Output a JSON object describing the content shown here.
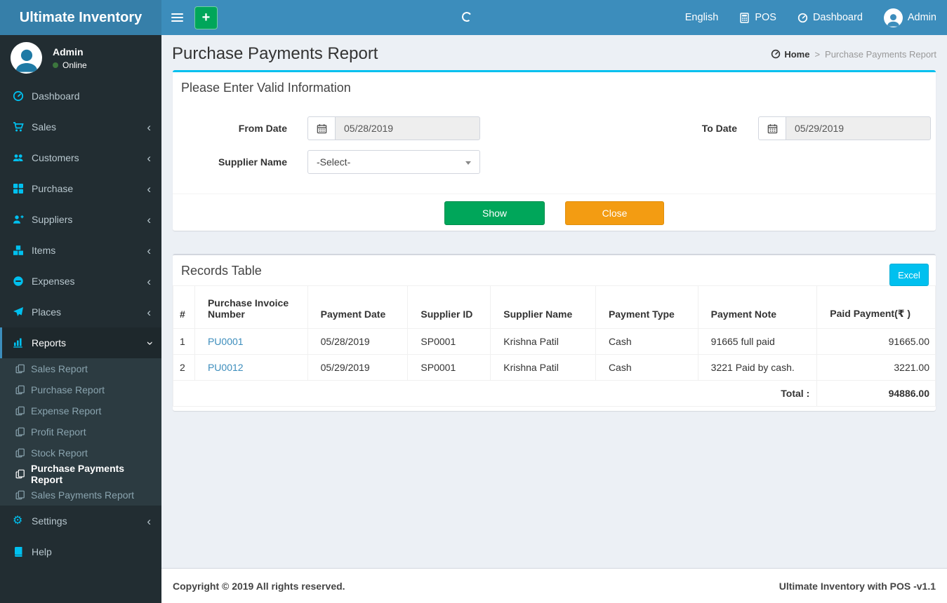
{
  "topbar": {
    "brand": "Ultimate Inventory",
    "language": "English",
    "pos_label": "POS",
    "dashboard_label": "Dashboard",
    "user_label": "Admin"
  },
  "sidebar": {
    "user_name": "Admin",
    "user_status": "Online",
    "items": [
      {
        "label": "Dashboard",
        "icon": "gauge-icon"
      },
      {
        "label": "Sales",
        "icon": "cart-icon"
      },
      {
        "label": "Customers",
        "icon": "users-icon"
      },
      {
        "label": "Purchase",
        "icon": "grid-icon"
      },
      {
        "label": "Suppliers",
        "icon": "user-plus-icon"
      },
      {
        "label": "Items",
        "icon": "cubes-icon"
      },
      {
        "label": "Expenses",
        "icon": "minus-circle-icon"
      },
      {
        "label": "Places",
        "icon": "paper-plane-icon"
      }
    ],
    "reports": {
      "label": "Reports",
      "icon": "bar-chart-icon"
    },
    "reports_submenu": [
      {
        "label": "Sales Report"
      },
      {
        "label": "Purchase Report"
      },
      {
        "label": "Expense Report"
      },
      {
        "label": "Profit Report"
      },
      {
        "label": "Stock Report"
      },
      {
        "label": "Purchase Payments Report",
        "active": true
      },
      {
        "label": "Sales Payments Report"
      }
    ],
    "settings": {
      "label": "Settings",
      "icon": "gear-icon"
    },
    "help": {
      "label": "Help",
      "icon": "book-icon"
    }
  },
  "page": {
    "title": "Purchase Payments Report",
    "breadcrumb_home": "Home",
    "breadcrumb_current": "Purchase Payments Report"
  },
  "filter": {
    "title": "Please Enter Valid Information",
    "from_date_label": "From Date",
    "from_date_value": "05/28/2019",
    "to_date_label": "To Date",
    "to_date_value": "05/29/2019",
    "supplier_label": "Supplier Name",
    "supplier_value": "-Select-",
    "show_label": "Show",
    "close_label": "Close"
  },
  "records": {
    "title": "Records Table",
    "excel_label": "Excel",
    "headers": [
      "#",
      "Purchase Invoice Number",
      "Payment Date",
      "Supplier ID",
      "Supplier Name",
      "Payment Type",
      "Payment Note",
      "Paid Payment(₹ )"
    ],
    "rows": [
      {
        "num": "1",
        "invoice": "PU0001",
        "date": "05/28/2019",
        "supplier_id": "SP0001",
        "supplier_name": "Krishna Patil",
        "type": "Cash",
        "note": "91665 full paid",
        "amount": "91665.00"
      },
      {
        "num": "2",
        "invoice": "PU0012",
        "date": "05/29/2019",
        "supplier_id": "SP0001",
        "supplier_name": "Krishna Patil",
        "type": "Cash",
        "note": "3221 Paid by cash.",
        "amount": "3221.00"
      }
    ],
    "total_label": "Total :",
    "total_value": "94886.00"
  },
  "footer": {
    "left": "Copyright © 2019 All rights reserved.",
    "right": "Ultimate Inventory with POS -v1.1"
  },
  "colors": {
    "navbar": "#3c8dbc",
    "logo_bg": "#367fa9",
    "sidebar": "#222d32",
    "submenu_bg": "#2c3b41",
    "icon_accent": "#00c0ef",
    "success": "#00a65a",
    "warning": "#f39c12",
    "info": "#00c0ef",
    "content_bg": "#ecf0f5"
  }
}
